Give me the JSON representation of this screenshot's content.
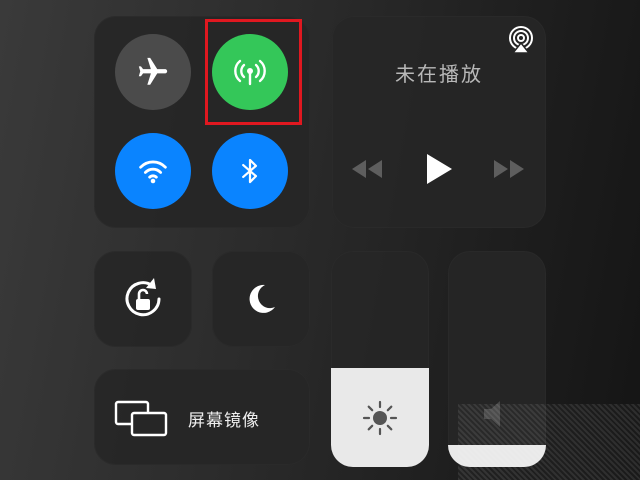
{
  "connectivity": {
    "airplane": {
      "icon": "airplane-icon",
      "active": false
    },
    "cellular": {
      "icon": "cellular-antenna-icon",
      "active": true
    },
    "wifi": {
      "icon": "wifi-icon",
      "active": true
    },
    "bluetooth": {
      "icon": "bluetooth-icon",
      "active": true
    }
  },
  "media": {
    "title": "未在播放",
    "airplay_icon": "airplay-icon",
    "rewind_icon": "rewind-icon",
    "play_icon": "play-icon",
    "forward_icon": "fast-forward-icon"
  },
  "controls": {
    "rotation_lock_icon": "rotation-lock-icon",
    "do_not_disturb_icon": "moon-icon"
  },
  "screen_mirroring": {
    "label": "屏幕镜像",
    "icon": "screen-mirroring-icon"
  },
  "brightness": {
    "level": 0.46,
    "icon": "sun-icon"
  },
  "volume": {
    "level": 0.1,
    "icon": "speaker-icon"
  },
  "colors": {
    "green": "#34c759",
    "blue": "#0a84ff",
    "gray_circle": "#4a4a4a",
    "highlight_border": "#e01820",
    "slider_fill": "#e9e9e9"
  }
}
